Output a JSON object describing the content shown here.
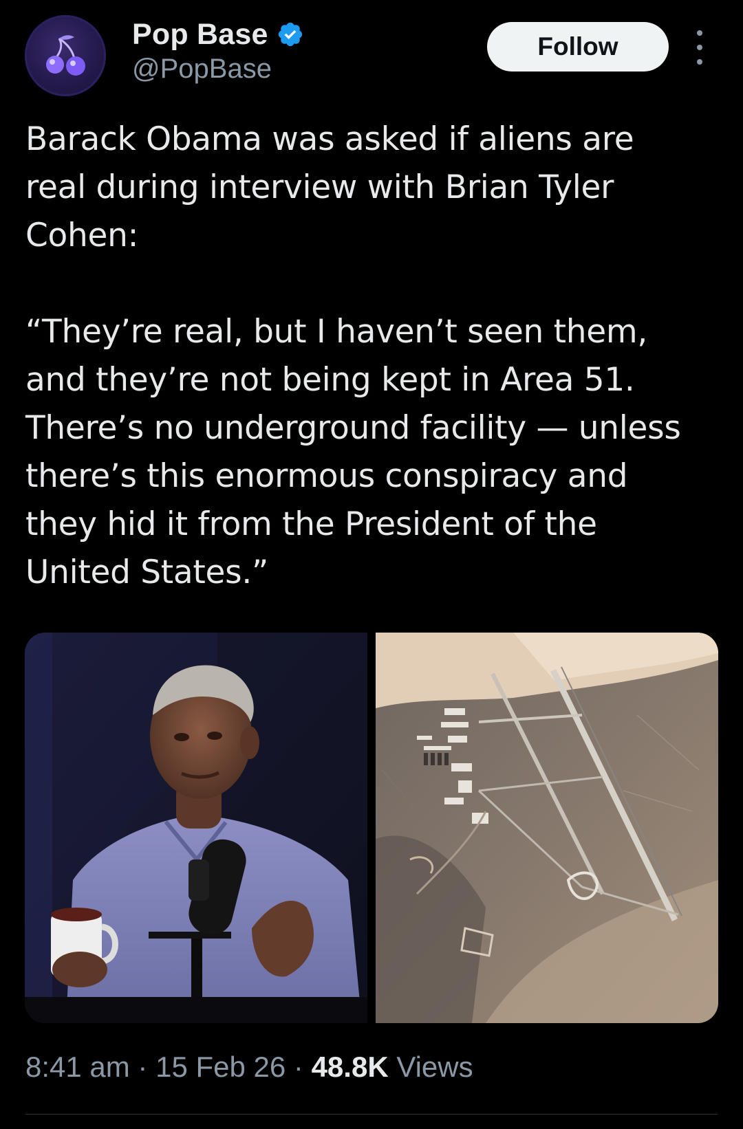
{
  "author": {
    "name": "Pop Base",
    "handle": "@PopBase",
    "verified": true,
    "avatar_icon": "cherries-icon"
  },
  "actions": {
    "follow_label": "Follow",
    "more_icon": "more-vertical-icon"
  },
  "tweet": {
    "text": "Barack Obama was asked if aliens are\nreal during interview with Brian Tyler\nCohen:\n\n“They’re real, but I haven’t seen them,\nand they’re not being kept in Area 51.\nThere’s no underground facility — unless\nthere’s this enormous conspiracy and\nthey hid it from the President of the\nUnited States.”"
  },
  "media": [
    {
      "kind": "photo",
      "subject": "man-speaking-at-microphone"
    },
    {
      "kind": "photo",
      "subject": "aerial-airbase-satellite-view"
    }
  ],
  "meta": {
    "time": "8:41 am",
    "separator": " · ",
    "date": "15 Feb 26",
    "views_count": "48.8K",
    "views_label": " Views"
  },
  "colors": {
    "background": "#000000",
    "text": "#e7e9ea",
    "secondary_text": "#8b98a5",
    "verified_blue": "#1d9bf0",
    "follow_bg": "#eff3f4"
  }
}
